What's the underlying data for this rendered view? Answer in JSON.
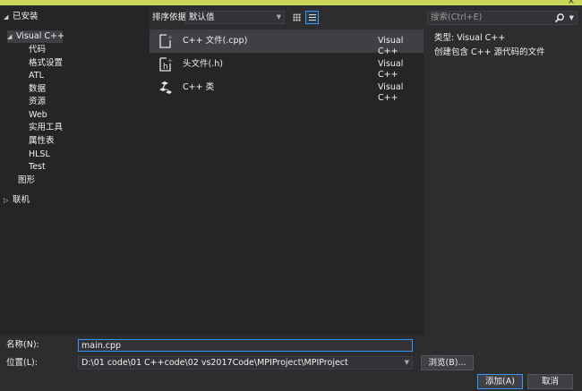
{
  "window": {
    "close_glyph": "×"
  },
  "tree": {
    "installed_label": "已安装",
    "visual_cpp_label": "Visual C++",
    "children": [
      "代码",
      "格式设置",
      "ATL",
      "数据",
      "资源",
      "Web",
      "实用工具",
      "属性表",
      "HLSL",
      "Test"
    ],
    "graphics_label": "图形",
    "online_label": "联机"
  },
  "toolbar": {
    "sort_label": "排序依据:",
    "sort_value": "默认值",
    "grid_view_icon": "grid-view-icon",
    "list_view_icon": "list-view-icon"
  },
  "templates": [
    {
      "name": "C++ 文件(.cpp)",
      "language": "Visual C++",
      "icon": "cpp-file-icon",
      "selected": true
    },
    {
      "name": "头文件(.h)",
      "language": "Visual C++",
      "icon": "header-file-icon",
      "selected": false
    },
    {
      "name": "C++ 类",
      "language": "Visual C++",
      "icon": "cpp-class-icon",
      "selected": false
    }
  ],
  "search": {
    "placeholder": "搜索(Ctrl+E)",
    "icon": "search-icon"
  },
  "details": {
    "type_label": "类型:",
    "type_value": "Visual C++",
    "description": "创建包含 C++ 源代码的文件"
  },
  "form": {
    "name_label": "名称(N):",
    "name_value": "main.cpp",
    "location_label": "位置(L):",
    "location_value": "D:\\01 code\\01 C++code\\02 vs2017Code\\MPIProject\\MPIProject",
    "browse_label": "浏览(B)...",
    "add_label": "添加(A)",
    "cancel_label": "取消"
  },
  "colors": {
    "background": "#2d2d30",
    "panel": "#252526",
    "selection": "#3f3f46",
    "accent": "#3399ff",
    "title_bar": "#ccd65a",
    "icon_magenta": "#c586c0"
  }
}
